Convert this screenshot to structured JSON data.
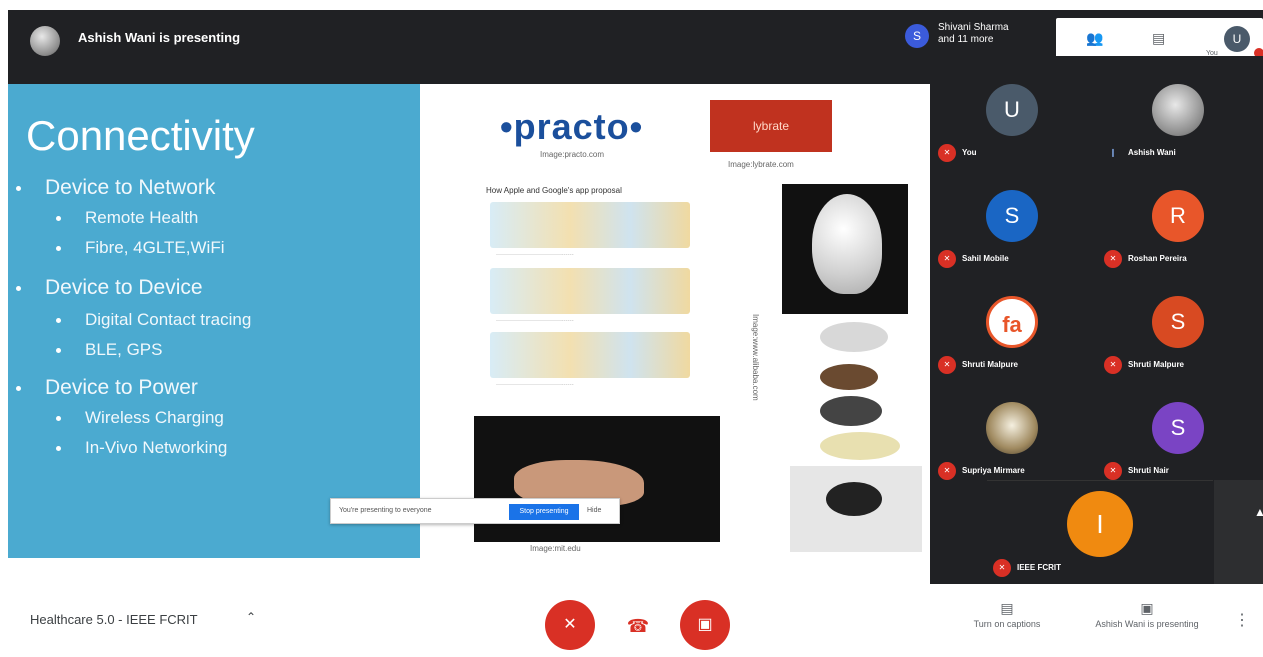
{
  "top": {
    "presenting_text": "Ashish Wani is presenting",
    "people_badge": "S",
    "people_text": "Shivani Sharma and 11 more",
    "self_initial": "U",
    "self_label": "You"
  },
  "slide": {
    "title": "Connectivity",
    "bullets": [
      {
        "text": "Device to Network",
        "level": 1
      },
      {
        "text": "Remote Health",
        "level": 2
      },
      {
        "text": "Fibre, 4GLTE,WiFi",
        "level": 2
      },
      {
        "text": "Device to Device",
        "level": 1
      },
      {
        "text": "Digital Contact tracing",
        "level": 2
      },
      {
        "text": "BLE, GPS",
        "level": 2
      },
      {
        "text": "Device to Power",
        "level": 1
      },
      {
        "text": "Wireless Charging",
        "level": 2
      },
      {
        "text": "In-Vivo Networking",
        "level": 2
      }
    ],
    "logo_practo": "•practo•",
    "caption_practo": "Image:practo.com",
    "logo_lybrate": "lybrate",
    "caption_lybrate": "Image:lybrate.com",
    "infographic_title": "How Apple and Google's app proposal",
    "caption_photo": "Image:mit.edu",
    "caption_vertical": "Image:www.alibaba.com"
  },
  "toast": {
    "text": "You're presenting to everyone",
    "stop_label": "Stop presenting",
    "hide_label": "Hide"
  },
  "participants": [
    {
      "name": "You",
      "initial": "U",
      "color": "#4a5a6a"
    },
    {
      "name": "Ashish Wani",
      "initial": "",
      "color": "#7a8a98"
    },
    {
      "name": "Sahil Mobile",
      "initial": "S",
      "color": "#1a66c4"
    },
    {
      "name": "Roshan Pereira",
      "initial": "R",
      "color": "#e8562a"
    },
    {
      "name": "Shruti Malpure",
      "initial": "fa",
      "color": "#ffffff"
    },
    {
      "name": "Shruti Malpure",
      "initial": "S",
      "color": "#d84a22"
    },
    {
      "name": "Supriya Mirmare",
      "initial": "",
      "color": "#8a7a60"
    },
    {
      "name": "Shruti Nair",
      "initial": "S",
      "color": "#7a44c4"
    },
    {
      "name": "IEEE FCRIT",
      "initial": "I",
      "color": "#f08a10"
    }
  ],
  "bottom": {
    "meeting_title": "Healthcare 5.0 - IEEE FCRIT",
    "captions_label": "Turn on captions",
    "presenting_label": "Ashish Wani is presenting"
  },
  "colors": {
    "slide_blue": "#4baad0",
    "danger_red": "#d93025",
    "dark_bg": "#202124"
  }
}
